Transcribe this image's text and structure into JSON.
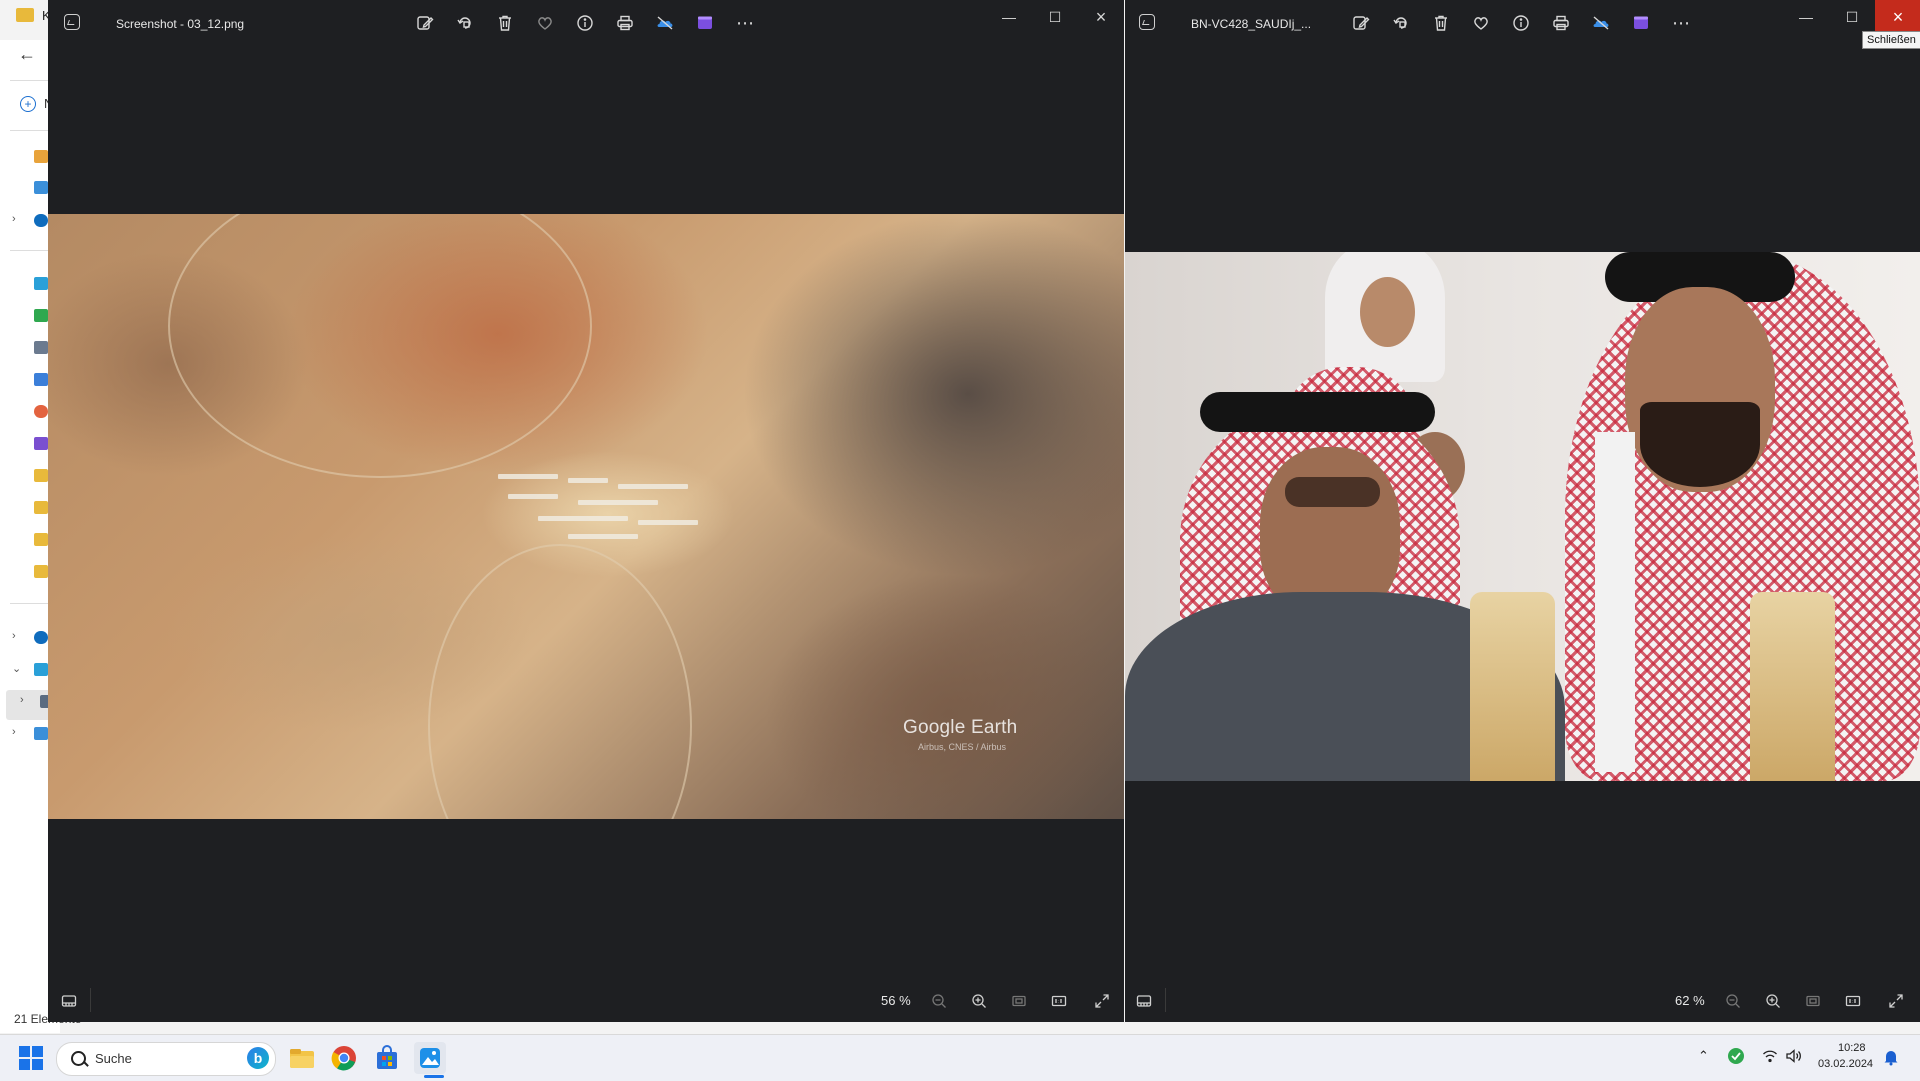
{
  "explorer": {
    "title_fragment": "K",
    "new_fragment": "N",
    "status_text": "21 Elemente",
    "nav_icons": [
      "home-icon",
      "gallery-icon",
      "onedrive-icon",
      "desktop-icon",
      "downloads-icon",
      "documents-icon",
      "pictures-icon",
      "music-icon",
      "videos-icon",
      "folder-icon",
      "folder-icon",
      "folder-icon",
      "folder-icon",
      "onedrive-icon",
      "this-pc-icon",
      "drive-icon",
      "network-icon"
    ]
  },
  "left_window": {
    "title": "Screenshot - 03_12.png",
    "zoom": "56 %",
    "favorite": false,
    "image_watermark": "Google Earth",
    "image_credit": "Airbus, CNES / Airbus",
    "image_subject": "satellite-view-mountain-facility"
  },
  "right_window": {
    "title": "BN-VC428_SAUDIj_...",
    "zoom": "62 %",
    "favorite": false,
    "image_subject": "portrait-photo",
    "close_tooltip": "Schließen"
  },
  "toolbar_icons": [
    "edit-icon",
    "rotate-icon",
    "delete-icon",
    "favorite-icon",
    "info-icon",
    "print-icon",
    "onedrive-icon",
    "clipchamp-icon",
    "more-icon"
  ],
  "taskbar": {
    "search_placeholder": "Suche",
    "apps": [
      "file-explorer-icon",
      "chrome-icon",
      "store-icon",
      "photos-icon"
    ],
    "time": "10:28",
    "date": "03.02.2024"
  },
  "colors": {
    "viewer_bg": "#1e1f22",
    "close_hover": "#c42b1c",
    "accent": "#1a73e8"
  }
}
